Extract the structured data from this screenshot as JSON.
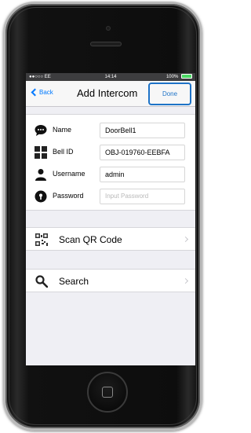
{
  "status_bar": {
    "carrier": "●●○○○ EE",
    "time": "14:14",
    "battery": "100%"
  },
  "nav": {
    "back_label": "Back",
    "title": "Add Intercom",
    "done_label": "Done"
  },
  "form": {
    "name_label": "Name",
    "name_value": "DoorBell1",
    "bell_id_label": "Bell ID",
    "bell_id_value": "OBJ-019760-EEBFA",
    "username_label": "Username",
    "username_value": "admin",
    "password_label": "Password",
    "password_placeholder": "Input Password"
  },
  "actions": {
    "scan_label": "Scan QR Code",
    "search_label": "Search"
  },
  "colors": {
    "accent": "#007aff",
    "done_highlight": "#1e73c7",
    "background": "#efeff4"
  }
}
